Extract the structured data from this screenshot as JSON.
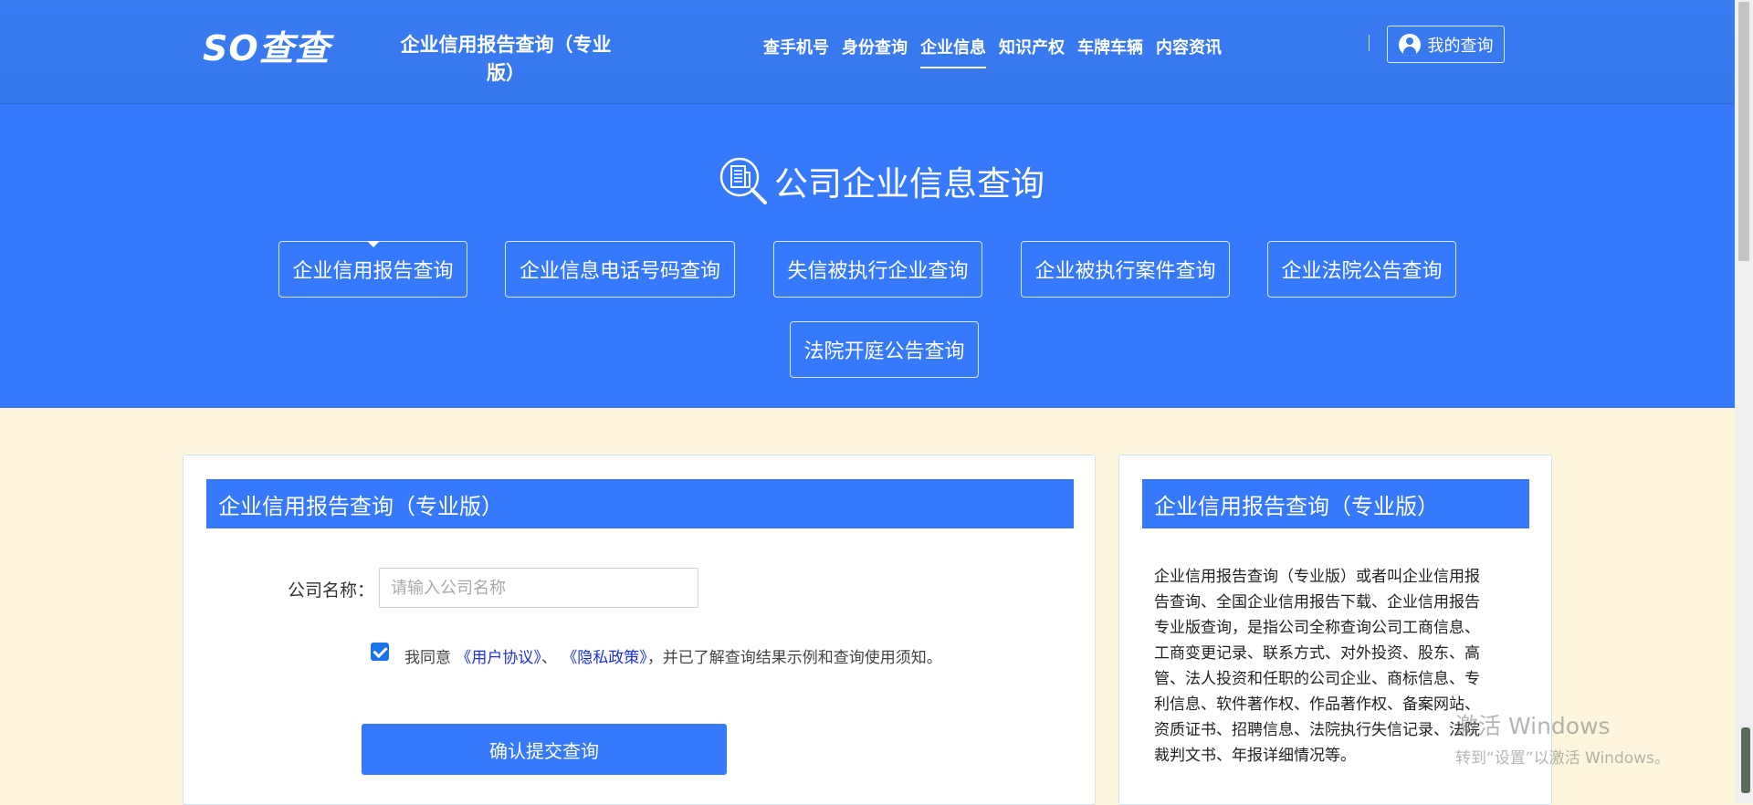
{
  "brand": {
    "logo_text": "SO查查",
    "site_title": "企业信用报告查询（专业版）"
  },
  "nav": {
    "items": [
      {
        "label": "查手机号"
      },
      {
        "label": "身份查询"
      },
      {
        "label": "企业信息",
        "active": true
      },
      {
        "label": "知识产权"
      },
      {
        "label": "车牌车辆"
      },
      {
        "label": "内容资讯"
      }
    ],
    "my_query": "我的查询"
  },
  "hero": {
    "title": "公司企业信息查询",
    "services": [
      {
        "label": "企业信用报告查询",
        "active": true
      },
      {
        "label": "企业信息电话号码查询"
      },
      {
        "label": "失信被执行企业查询"
      },
      {
        "label": "企业被执行案件查询"
      },
      {
        "label": "企业法院公告查询"
      },
      {
        "label": "法院开庭公告查询"
      }
    ]
  },
  "form_card": {
    "heading": "企业信用报告查询（专业版）",
    "company_label": "公司名称：",
    "company_placeholder": "请输入公司名称",
    "company_value": "",
    "agree_checked": true,
    "agree_prefix": "我同意",
    "user_agreement": "《用户协议》",
    "separator": "、",
    "privacy_policy": "《隐私政策》",
    "agree_suffix": "，并已了解查询结果示例和查询使用须知。",
    "submit": "确认提交查询"
  },
  "info_card": {
    "heading": "企业信用报告查询（专业版）",
    "description": "企业信用报告查询（专业版）或者叫企业信用报告查询、全国企业信用报告下载、企业信用报告专业版查询，是指公司全称查询公司工商信息、工商变更记录、联系方式、对外投资、股东、高管、法人投资和任职的公司企业、商标信息、专利信息、软件著作权、作品著作权、备案网站、资质证书、招聘信息、法院执行失信记录、法院裁判文书、年报详细情况等。"
  },
  "watermark": {
    "line1": "激活 Windows",
    "line2": "转到“设置”以激活 Windows。"
  },
  "colors": {
    "primary": "#3679fc",
    "header": "#3777ee",
    "page_bg": "#fdf6dc",
    "link": "#1a34d8"
  }
}
